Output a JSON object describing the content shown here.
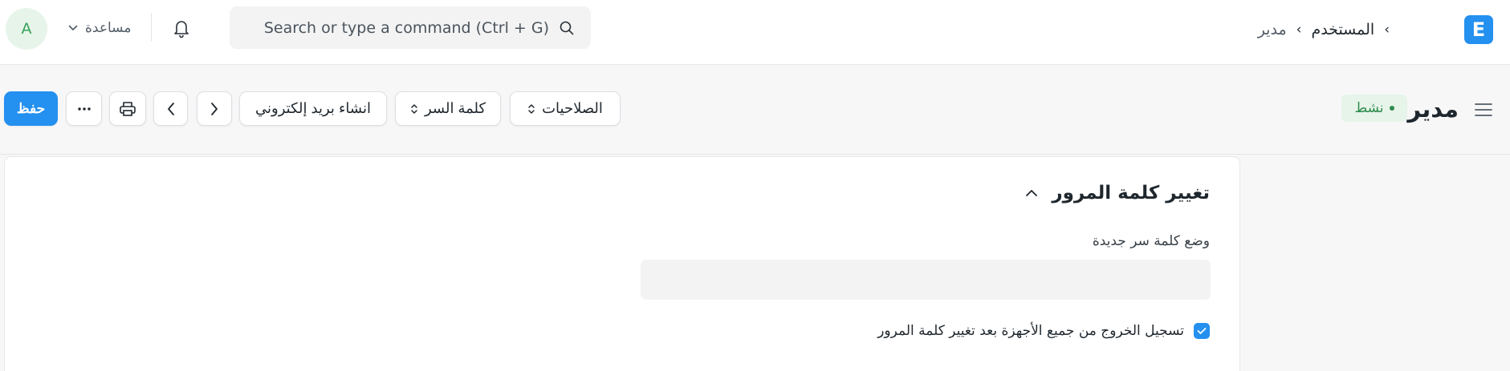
{
  "navbar": {
    "avatar_initial": "A",
    "help_label": "مساعدة",
    "search_placeholder": "Search or type a command (Ctrl + G)",
    "breadcrumb": [
      "المستخدم",
      "مدير"
    ],
    "logo_letter": "E"
  },
  "page": {
    "title": "مدير",
    "status": "نشط",
    "buttons": {
      "save": "حفظ",
      "create_email": "انشاء بريد إلكتروني",
      "password": "كلمة السر",
      "permissions": "الصلاحيات"
    }
  },
  "form": {
    "section_title": "تغيير كلمة المرور",
    "new_password_label": "وضع كلمة سر جديدة",
    "new_password_value": "",
    "logout_all_label": "تسجيل الخروج من جميع الأجهزة بعد تغيير كلمة المرور",
    "logout_all_checked": true
  },
  "colors": {
    "primary": "#2490ef",
    "success": "#2c8b4c",
    "success_bg": "#e6f4ea"
  }
}
